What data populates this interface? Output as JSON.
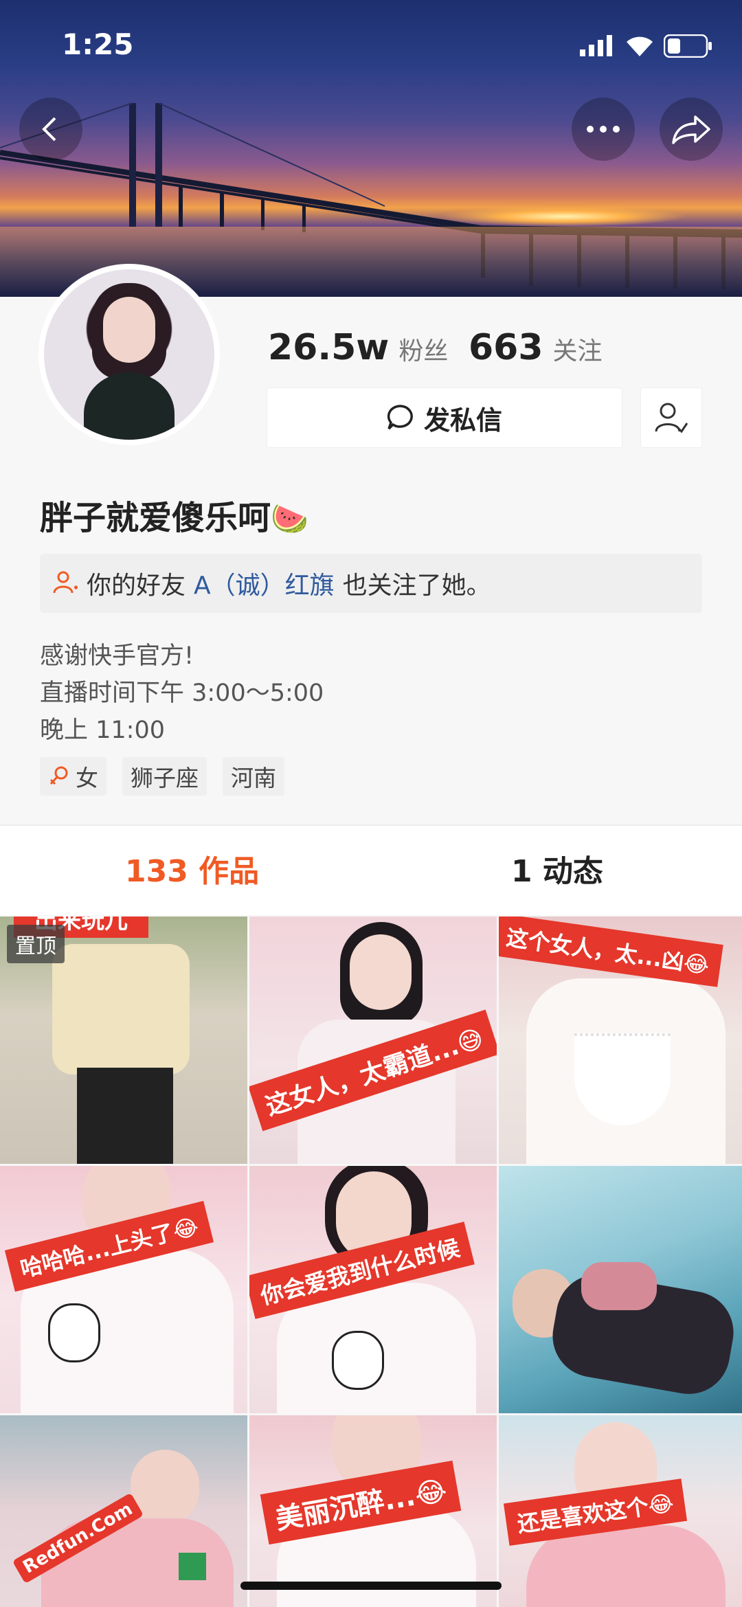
{
  "status_bar": {
    "time": "1:25"
  },
  "profile": {
    "followers_num": "26.5w",
    "followers_label": "粉丝",
    "following_num": "663",
    "following_label": "关注",
    "message_label": "发私信",
    "name": "胖子就爱傻乐呵",
    "name_emoji": "🍉",
    "friend_prefix": "你的好友",
    "friend_name": "A（诚）红旗",
    "friend_suffix": "也关注了她。",
    "bio": [
      "感谢快手官方!",
      "直播时间下午 3:00～5:00",
      "晚上 11:00"
    ],
    "tags": {
      "gender": "女",
      "zodiac": "狮子座",
      "region": "河南"
    }
  },
  "tabs": {
    "works": "133 作品",
    "moments": "1 动态"
  },
  "grid": {
    "pinned_badge": "置顶",
    "top_banner_text": "出来玩儿",
    "captions": [
      "这女人，太霸道...😅",
      "这个女人，太...凶😂",
      "哈哈哈...上头了😂",
      "你会爱我到什么时候",
      "美丽沉醉...😂",
      "还是喜欢这个😂"
    ],
    "watermark": "Redfun.Com"
  },
  "colors": {
    "accent": "#f05a24",
    "link": "#2f5a9e",
    "red": "#e5372b"
  }
}
